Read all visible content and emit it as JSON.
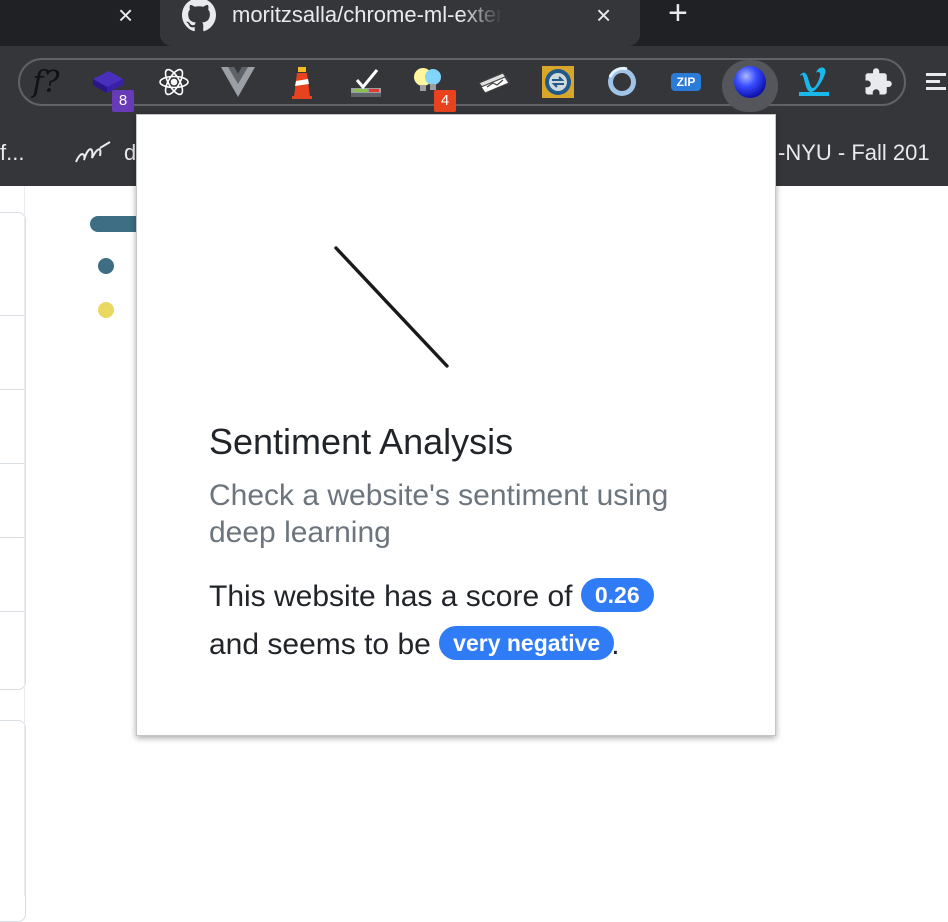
{
  "tabs": {
    "active_title": "moritzsalla/chrome-ml-extension",
    "close_glyph": "×",
    "new_tab_glyph": "+"
  },
  "toolbar": {
    "extensions": [
      {
        "name": "f-question-extension",
        "label": "f?"
      },
      {
        "name": "stack-extension",
        "badge": "8",
        "badge_color": "#673ab7"
      },
      {
        "name": "react-devtools-extension"
      },
      {
        "name": "vue-devtools-extension"
      },
      {
        "name": "lighthouse-extension"
      },
      {
        "name": "checklist-extension"
      },
      {
        "name": "bulbs-extension",
        "badge": "4",
        "badge_color": "#e8431e"
      },
      {
        "name": "cards-extension"
      },
      {
        "name": "currency-extension"
      },
      {
        "name": "ring-extension"
      },
      {
        "name": "zip-extension",
        "label": "ZIP"
      },
      {
        "name": "sentiment-extension"
      },
      {
        "name": "vimeo-extension"
      },
      {
        "name": "puzzle-icon"
      }
    ]
  },
  "bookmarks": {
    "left_text": "f...",
    "item_text": "d",
    "right_text": "-NYU - Fall 201"
  },
  "popup": {
    "title": "Sentiment Analysis",
    "subtitle": "Check a website's sentiment using deep learning",
    "sentence_1": "This website has a score of",
    "score": "0.26",
    "sentence_2": "and seems to be",
    "verdict": "very negative",
    "period": "."
  },
  "colors": {
    "badge": "#2f7cf6",
    "lang_dot_1": "#3d6e83",
    "lang_dot_2": "#e9d961"
  }
}
